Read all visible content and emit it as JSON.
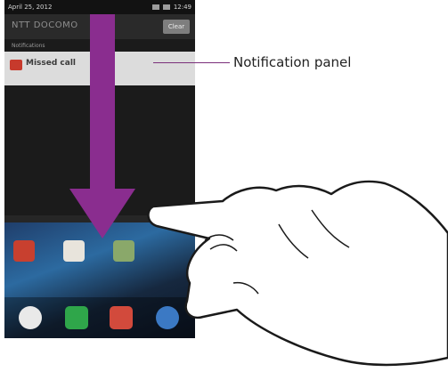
{
  "statusbar": {
    "date": "April 25, 2012",
    "time": "12:49"
  },
  "panel": {
    "carrier": "NTT DOCOMO",
    "clear_label": "Clear",
    "section_label": "Notifications",
    "notification": {
      "title": "Missed call",
      "subtitle": "",
      "time": ""
    }
  },
  "callout": {
    "label": "Notification panel"
  },
  "colors": {
    "arrow": "#8a2d8f",
    "callout_line": "#7a2f7a"
  },
  "icons": {
    "home_apps": [
      "messages-icon",
      "settings-icon",
      "gallery-icon"
    ],
    "dock": [
      "apps-icon",
      "phone-icon",
      "email-icon",
      "browser-icon"
    ]
  }
}
